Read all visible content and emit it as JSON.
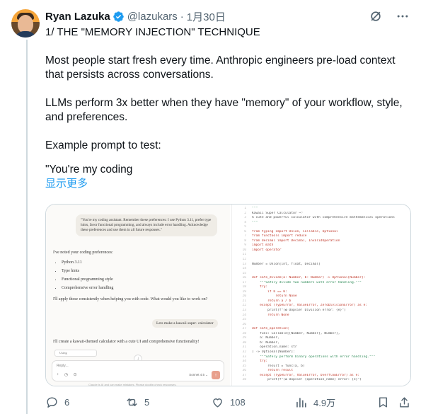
{
  "header": {
    "name": "Ryan Lazuka",
    "handle": "@lazukars",
    "separator": "·",
    "date": "1月30日"
  },
  "tweet": {
    "lines": [
      "1/ THE \"MEMORY INJECTION\" TECHNIQUE",
      "",
      "Most people start fresh every time. Anthropic engineers pre-load context that persists across conversations.",
      "",
      "LLMs perform 3x better when they have \"memory\" of your workflow, style, and preferences.",
      "",
      "Example prompt to test:",
      "",
      "\"You're my coding"
    ],
    "show_more": "显示更多"
  },
  "media": {
    "chat": {
      "user_message": "\"You're my coding assistant. Remember these preferences: I use Python 3.11, prefer type hints, favor functional programming, and always include error handling. Acknowledge these preferences and use them in all future responses.\"",
      "reply_intro": "I've noted your coding preferences:",
      "bullets": [
        "Python 3.11",
        "Type hints",
        "Functional programming style",
        "Comprehensive error handling"
      ],
      "reply_outro": "I'll apply these consistently when helping you with code. What would you like to work on?",
      "user_message_2": "Lets make a kawaii super- calculator",
      "reply_2": "I'll create a kawaii-themed calculator with a cute UI and comprehensive functionality!",
      "artifact_chip": "Using",
      "composer_placeholder": "Reply...",
      "composer_tools": "+ ◷ ⊙",
      "model_label": "Sonnet 4.5 ⌄",
      "send_icon": "↑",
      "scroll_icon": "↓",
      "footnote": "Claude is AI and can make mistakes. Please double-check responses."
    },
    "code_lines": [
      {
        "n": "1",
        "t": "\"\"\""
      },
      {
        "n": "2",
        "t": "Kawaii Super Calculator ~♡"
      },
      {
        "n": "3",
        "t": "A cute and powerful calculator with comprehensive mathematical operations"
      },
      {
        "n": "4",
        "t": "\"\"\""
      },
      {
        "n": "5",
        "t": ""
      },
      {
        "n": "6",
        "t": "from typing import Union, Callable, Optional"
      },
      {
        "n": "7",
        "t": "from functools import reduce"
      },
      {
        "n": "8",
        "t": "from decimal import Decimal, InvalidOperation"
      },
      {
        "n": "9",
        "t": "import math"
      },
      {
        "n": "10",
        "t": "import operator"
      },
      {
        "n": "11",
        "t": ""
      },
      {
        "n": "12",
        "t": ""
      },
      {
        "n": "13",
        "t": "Number = Union[int, float, Decimal]"
      },
      {
        "n": "14",
        "t": ""
      },
      {
        "n": "15",
        "t": ""
      },
      {
        "n": "16",
        "t": "def safe_divide(a: Number, b: Number) -> Optional[Number]:"
      },
      {
        "n": "17",
        "t": "    \"\"\"Safely divide two numbers with error handling.\"\"\""
      },
      {
        "n": "18",
        "t": "    try:"
      },
      {
        "n": "19",
        "t": "        if b == 0:"
      },
      {
        "n": "20",
        "t": "            return None"
      },
      {
        "n": "21",
        "t": "        return a / b"
      },
      {
        "n": "22",
        "t": "    except (TypeError, ValueError, ZeroDivisionError) as e:"
      },
      {
        "n": "23",
        "t": "        print(f\"(✿ Oopsie! Division error: {e}\")"
      },
      {
        "n": "24",
        "t": "        return None"
      },
      {
        "n": "25",
        "t": ""
      },
      {
        "n": "26",
        "t": ""
      },
      {
        "n": "27",
        "t": "def safe_operation("
      },
      {
        "n": "28",
        "t": "    func: Callable[[Number, Number], Number],"
      },
      {
        "n": "29",
        "t": "    a: Number,"
      },
      {
        "n": "30",
        "t": "    b: Number,"
      },
      {
        "n": "31",
        "t": "    operation_name: str"
      },
      {
        "n": "32",
        "t": ") -> Optional[Number]:"
      },
      {
        "n": "33",
        "t": "    \"\"\"Safely perform binary operations with error handling.\"\"\""
      },
      {
        "n": "34",
        "t": "    try:"
      },
      {
        "n": "35",
        "t": "        result = func(a, b)"
      },
      {
        "n": "36",
        "t": "        return result"
      },
      {
        "n": "37",
        "t": "    except (TypeError, ValueError, OverflowError) as e:"
      },
      {
        "n": "38",
        "t": "        print(f\"(✿ Oopsie! {operation_name} error: {e}\")"
      }
    ]
  },
  "actions": {
    "replies": "6",
    "reposts": "5",
    "likes": "108",
    "views": "4.9万"
  },
  "colors": {
    "link": "#1d9bf0",
    "muted": "#536471",
    "verified": "#1d9bf0"
  }
}
